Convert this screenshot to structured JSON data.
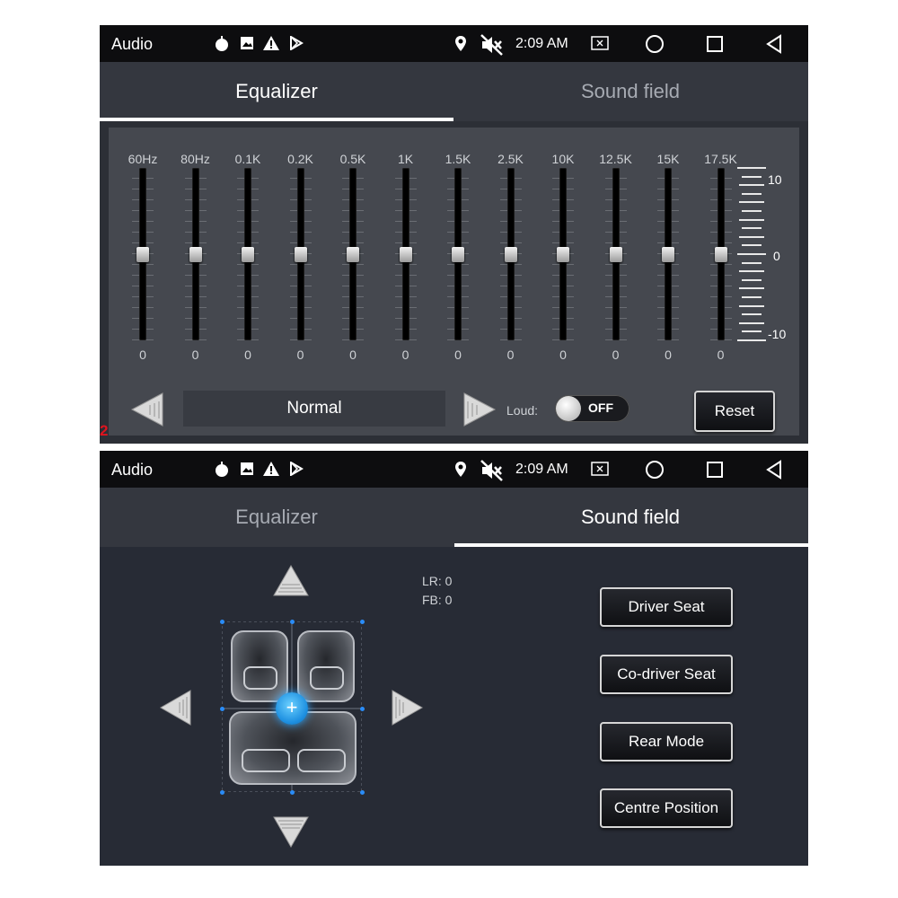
{
  "marker": "2",
  "statusbar": {
    "app_title": "Audio",
    "time": "2:09 AM",
    "left_icons": [
      "android-icon",
      "image-icon",
      "warning-icon",
      "play-store-icon"
    ],
    "right_icons": [
      "location-icon",
      "mute-icon"
    ],
    "nav_icons": [
      "screenshot-icon",
      "home-icon",
      "recents-icon",
      "back-icon"
    ]
  },
  "tabs": {
    "equalizer": "Equalizer",
    "sound_field": "Sound field"
  },
  "equalizer": {
    "bands": [
      {
        "label": "60Hz",
        "value": "0"
      },
      {
        "label": "80Hz",
        "value": "0"
      },
      {
        "label": "0.1K",
        "value": "0"
      },
      {
        "label": "0.2K",
        "value": "0"
      },
      {
        "label": "0.5K",
        "value": "0"
      },
      {
        "label": "1K",
        "value": "0"
      },
      {
        "label": "1.5K",
        "value": "0"
      },
      {
        "label": "2.5K",
        "value": "0"
      },
      {
        "label": "10K",
        "value": "0"
      },
      {
        "label": "12.5K",
        "value": "0"
      },
      {
        "label": "15K",
        "value": "0"
      },
      {
        "label": "17.5K",
        "value": "0"
      }
    ],
    "scale": {
      "max": "10",
      "mid": "0",
      "min": "-10"
    },
    "preset": "Normal",
    "loud_label": "Loud:",
    "loud_state": "OFF",
    "reset_label": "Reset"
  },
  "sound_field": {
    "lr": "LR: 0",
    "fb": "FB: 0",
    "buttons": {
      "driver_seat": "Driver Seat",
      "co_driver_seat": "Co-driver Seat",
      "rear_mode": "Rear Mode",
      "centre_position": "Centre Position"
    }
  }
}
